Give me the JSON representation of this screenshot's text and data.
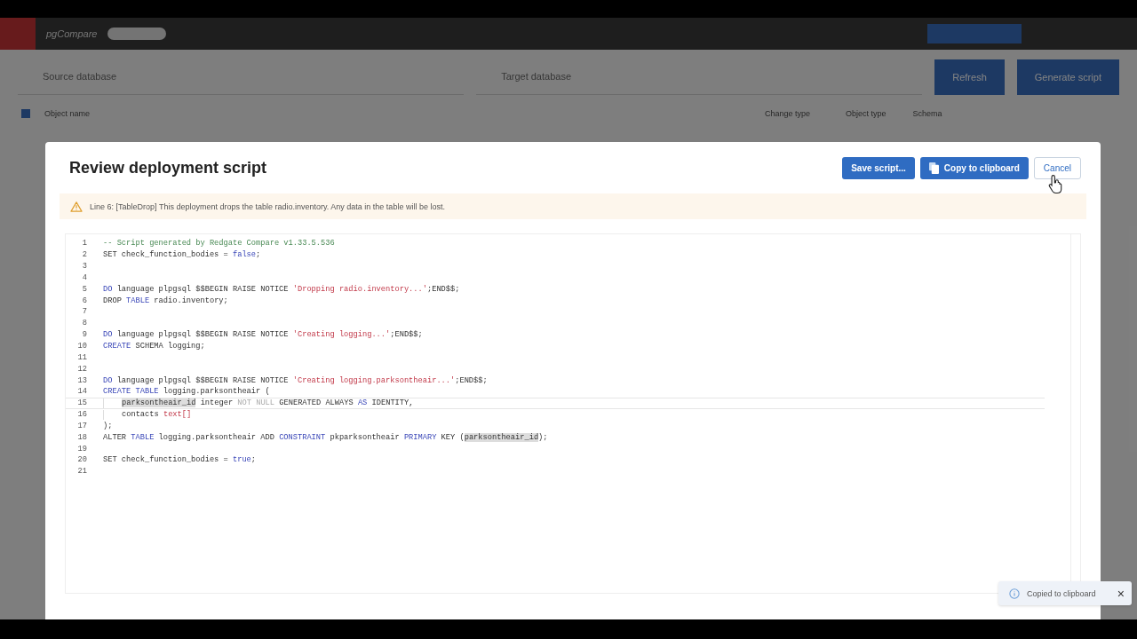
{
  "app": {
    "name": "pgCompare",
    "source_label": "Source database",
    "target_label": "Target database",
    "refresh": "Refresh",
    "generate": "Generate script",
    "select_all_checked": true,
    "columns": [
      "Object name",
      "Change type",
      "Object type",
      "Schema"
    ]
  },
  "dialog": {
    "title": "Review deployment script",
    "buttons": [
      {
        "label": "Save script...",
        "kind": "primary",
        "icon": false
      },
      {
        "label": "Copy to clipboard",
        "kind": "primary",
        "icon": true
      },
      {
        "label": "Cancel",
        "kind": "secondary",
        "icon": false
      }
    ],
    "warning": "Line 6: [TableDrop] This deployment drops the table radio.inventory. Any data in the table will be lost.",
    "lines": [
      {
        "number": "1",
        "current": false,
        "indented": false,
        "segments": [
          {
            "text": "-- Script generated by Redgate Compare v1.33.5.536",
            "kind": "comment"
          }
        ]
      },
      {
        "number": "2",
        "current": false,
        "indented": false,
        "segments": [
          {
            "text": "SET check_function_bodies = ",
            "kind": "plain"
          },
          {
            "text": "false",
            "kind": "keyword"
          },
          {
            "text": ";",
            "kind": "plain"
          }
        ]
      },
      {
        "number": "3",
        "current": false,
        "indented": false
      },
      {
        "number": "4",
        "current": false,
        "indented": false
      },
      {
        "number": "5",
        "current": false,
        "indented": false,
        "segments": [
          {
            "text": "DO",
            "kind": "keyword"
          },
          {
            "text": " language plpgsql $$BEGIN RAISE NOTICE ",
            "kind": "plain"
          },
          {
            "text": "'Dropping radio.inventory...'",
            "kind": "string"
          },
          {
            "text": ";END$$;",
            "kind": "plain"
          }
        ]
      },
      {
        "number": "6",
        "current": false,
        "indented": false,
        "segments": [
          {
            "text": "DROP ",
            "kind": "plain"
          },
          {
            "text": "TABLE",
            "kind": "keyword"
          },
          {
            "text": " radio.inventory;",
            "kind": "plain"
          }
        ]
      },
      {
        "number": "7",
        "current": false,
        "indented": false
      },
      {
        "number": "8",
        "current": false,
        "indented": false
      },
      {
        "number": "9",
        "current": false,
        "indented": false,
        "segments": [
          {
            "text": "DO",
            "kind": "keyword"
          },
          {
            "text": " language plpgsql $$BEGIN RAISE NOTICE ",
            "kind": "plain"
          },
          {
            "text": "'Creating logging...'",
            "kind": "string"
          },
          {
            "text": ";END$$;",
            "kind": "plain"
          }
        ]
      },
      {
        "number": "10",
        "current": false,
        "indented": false,
        "segments": [
          {
            "text": "CREATE",
            "kind": "keyword"
          },
          {
            "text": " SCHEMA logging;",
            "kind": "plain"
          }
        ]
      },
      {
        "number": "11",
        "current": false,
        "indented": false
      },
      {
        "number": "12",
        "current": false,
        "indented": false
      },
      {
        "number": "13",
        "current": false,
        "indented": false,
        "segments": [
          {
            "text": "DO",
            "kind": "keyword"
          },
          {
            "text": " language plpgsql $$BEGIN RAISE NOTICE ",
            "kind": "plain"
          },
          {
            "text": "'Creating logging.parksontheair...'",
            "kind": "string"
          },
          {
            "text": ";END$$;",
            "kind": "plain"
          }
        ]
      },
      {
        "number": "14",
        "current": false,
        "indented": false,
        "segments": [
          {
            "text": "CREATE",
            "kind": "keyword"
          },
          {
            "text": " TABLE",
            "kind": "keyword"
          },
          {
            "text": " logging.parksontheair (",
            "kind": "plain"
          }
        ]
      },
      {
        "number": "15",
        "current": true,
        "indented": true,
        "segments": [
          {
            "text": "parksontheair_id",
            "kind": "match"
          },
          {
            "text": " integer ",
            "kind": "plain"
          },
          {
            "text": "NOT NULL",
            "kind": "muted"
          },
          {
            "text": " GENERATED ALWAYS ",
            "kind": "plain"
          },
          {
            "text": "AS",
            "kind": "keyword"
          },
          {
            "text": " IDENTITY,",
            "kind": "plain"
          }
        ]
      },
      {
        "number": "16",
        "current": false,
        "indented": true,
        "segments": [
          {
            "text": "contacts ",
            "kind": "plain"
          },
          {
            "text": "text[]",
            "kind": "string"
          }
        ]
      },
      {
        "number": "17",
        "current": false,
        "indented": false,
        "segments": [
          {
            "text": ");",
            "kind": "plain"
          }
        ]
      },
      {
        "number": "18",
        "current": false,
        "indented": false,
        "segments": [
          {
            "text": "ALTER ",
            "kind": "plain"
          },
          {
            "text": "TABLE",
            "kind": "keyword"
          },
          {
            "text": " logging.parksontheair ADD ",
            "kind": "plain"
          },
          {
            "text": "CONSTRAINT",
            "kind": "keyword"
          },
          {
            "text": " pkparksontheair ",
            "kind": "plain"
          },
          {
            "text": "PRIMARY",
            "kind": "keyword"
          },
          {
            "text": " KEY (",
            "kind": "plain"
          },
          {
            "text": "parksontheair_id",
            "kind": "match"
          },
          {
            "text": ");",
            "kind": "plain"
          }
        ]
      },
      {
        "number": "19",
        "current": false,
        "indented": false
      },
      {
        "number": "20",
        "current": false,
        "indented": false,
        "segments": [
          {
            "text": "SET check_function_bodies = ",
            "kind": "plain"
          },
          {
            "text": "true",
            "kind": "keyword"
          },
          {
            "text": ";",
            "kind": "plain"
          }
        ]
      },
      {
        "number": "21",
        "current": false,
        "indented": false
      }
    ]
  },
  "toast": {
    "message": "Copied to clipboard",
    "close": "×"
  }
}
